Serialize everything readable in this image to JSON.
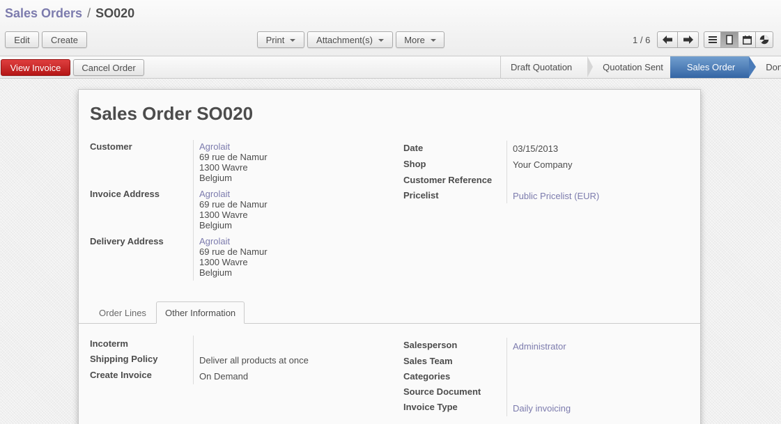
{
  "breadcrumb": {
    "parent": "Sales Orders",
    "separator": "/",
    "current": "SO020"
  },
  "toolbar": {
    "edit": "Edit",
    "create": "Create",
    "print": "Print",
    "attachments": "Attachment(s)",
    "more": "More"
  },
  "pager": {
    "text": "1 / 6",
    "prev_icon": "arrow-left-icon",
    "next_icon": "arrow-right-icon"
  },
  "view_switch": {
    "views": [
      "list-view-icon",
      "form-view-icon",
      "calendar-view-icon",
      "graph-view-icon"
    ],
    "active": "form-view-icon"
  },
  "actions": {
    "view_invoice": "View Invoice",
    "cancel_order": "Cancel Order"
  },
  "statusbar": {
    "stages": [
      "Draft Quotation",
      "Quotation Sent",
      "Sales Order",
      "Done"
    ],
    "active": "Sales Order"
  },
  "form": {
    "title": "Sales Order SO020",
    "customer": {
      "label": "Customer",
      "name": "Agrolait",
      "street": "69 rue de Namur",
      "city": "1300 Wavre",
      "country": "Belgium"
    },
    "invoice_address": {
      "label": "Invoice Address",
      "name": "Agrolait",
      "street": "69 rue de Namur",
      "city": "1300 Wavre",
      "country": "Belgium"
    },
    "delivery_address": {
      "label": "Delivery Address",
      "name": "Agrolait",
      "street": "69 rue de Namur",
      "city": "1300 Wavre",
      "country": "Belgium"
    },
    "date": {
      "label": "Date",
      "value": "03/15/2013"
    },
    "shop": {
      "label": "Shop",
      "value": "Your Company"
    },
    "customer_reference": {
      "label": "Customer Reference",
      "value": ""
    },
    "pricelist": {
      "label": "Pricelist",
      "value": "Public Pricelist (EUR)"
    }
  },
  "tabs": {
    "order_lines": "Order Lines",
    "other_information": "Other Information",
    "active": "Other Information"
  },
  "other_info": {
    "incoterm": {
      "label": "Incoterm",
      "value": ""
    },
    "shipping_policy": {
      "label": "Shipping Policy",
      "value": "Deliver all products at once"
    },
    "create_invoice": {
      "label": "Create Invoice",
      "value": "On Demand"
    },
    "salesperson": {
      "label": "Salesperson",
      "value": "Administrator"
    },
    "sales_team": {
      "label": "Sales Team",
      "value": ""
    },
    "categories": {
      "label": "Categories",
      "value": ""
    },
    "source_document": {
      "label": "Source Document",
      "value": ""
    },
    "invoice_type": {
      "label": "Invoice Type",
      "value": "Daily invoicing"
    }
  },
  "colors": {
    "link": "#7c7bad",
    "primary_button": "#c9302c",
    "active_stage": "#3465a4",
    "text": "#4c4c4c"
  }
}
